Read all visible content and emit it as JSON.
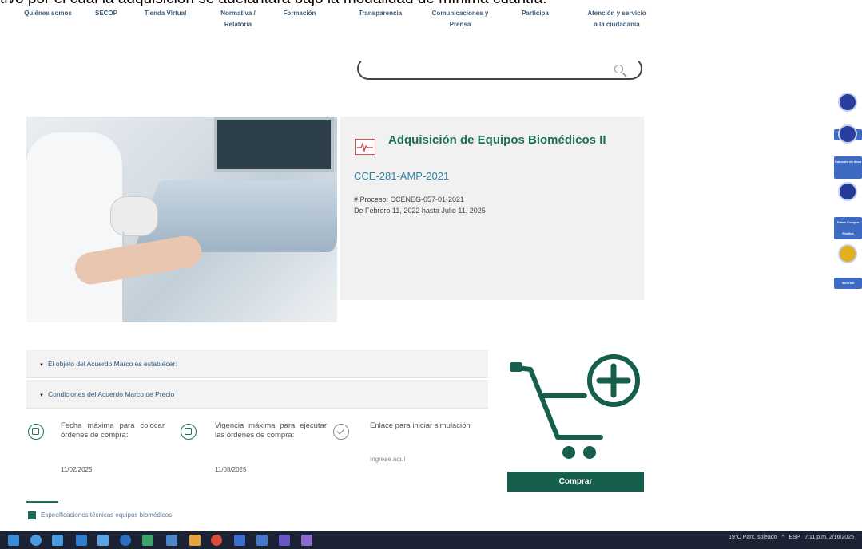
{
  "page_top_text": "tivo por el cual la adquisición se adelantará bajo la modalidad de mínima cuantía.",
  "nav": [
    {
      "label": "Quiénes somos"
    },
    {
      "label": "SECOP"
    },
    {
      "label": "Tienda Virtual"
    },
    {
      "label": "Normativa / Relatoría"
    },
    {
      "label": "Formación"
    },
    {
      "label": "Transparencia"
    },
    {
      "label": "Comunicaciones y Prensa"
    },
    {
      "label": "Participa"
    },
    {
      "label": "Atención y servicio a la ciudadanía"
    }
  ],
  "search": {
    "placeholder": ""
  },
  "product": {
    "title": "Adquisición de Equipos Biomédicos II",
    "code": "CCE-281-AMP-2021",
    "process": "# Proceso: CCENEG-057-01-2021",
    "dates": "De Febrero 11, 2022 hasta Julio 11, 2025"
  },
  "accordion": [
    {
      "label": "El objeto del Acuerdo Marco es establecer:"
    },
    {
      "label": "Condiciones del Acuerdo Marco de Precio"
    }
  ],
  "info_cols": [
    {
      "text": "Fecha máxima para colocar órdenes de compra:",
      "value": "11/02/2025",
      "icon": "calendar-icon"
    },
    {
      "text": "Vigencia máxima para ejecutar las órdenes de compra:",
      "value": "11/08/2025",
      "icon": "calendar-icon"
    },
    {
      "text": "Enlace para iniciar simulación",
      "value": "Ingrese aquí",
      "icon": "check-circle-icon"
    }
  ],
  "buy_button": "Comprar",
  "spec_link": "Especificaciones técnicas equipos biomédicos",
  "side_buttons": [
    {
      "label": "Pagos"
    },
    {
      "label": "Solución en línea"
    },
    {
      "label": "Datos Compra Pública"
    },
    {
      "label": "Sicoriss"
    }
  ],
  "taskbar": {
    "weather": "19°C Parc. soleado",
    "lang": "ESP",
    "time": "7:11 p.m.",
    "date": "2/16/2025"
  },
  "colors": {
    "brand_green": "#155f4c",
    "link_blue": "#2a86a2",
    "taskbar": "#1b2233",
    "side_blue": "#3f6ac4"
  }
}
